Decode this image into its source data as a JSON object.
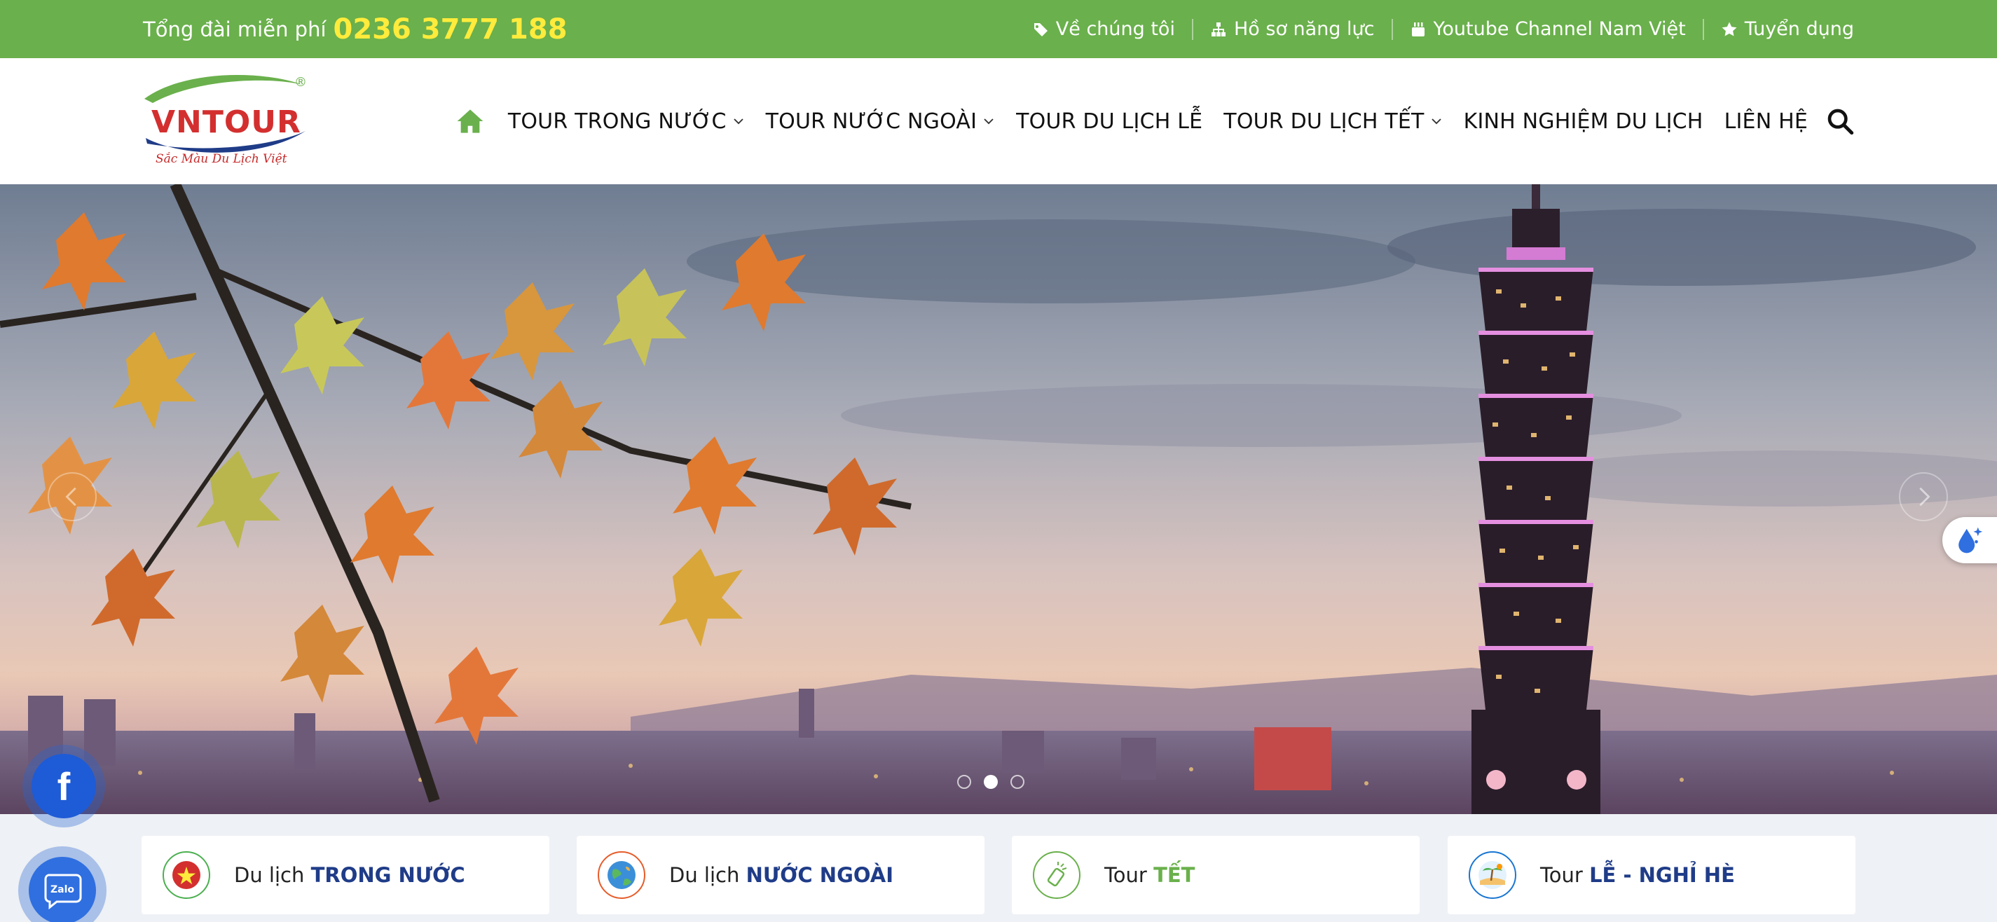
{
  "topbar": {
    "hotline_label": "Tổng đài miễn phí",
    "hotline_number": "0236 3777 188",
    "links": [
      {
        "label": "Về chúng tôi",
        "icon": "tag-icon"
      },
      {
        "label": "Hồ sơ năng lực",
        "icon": "sitemap-icon"
      },
      {
        "label": "Youtube Channel Nam Việt",
        "icon": "youtube-icon"
      },
      {
        "label": "Tuyển dụng",
        "icon": "star-icon"
      }
    ]
  },
  "header": {
    "logo_text": "VNTOUR",
    "logo_registered": "®",
    "logo_tagline": "Sắc Màu Du Lịch Việt",
    "nav": [
      {
        "label": "TOUR TRONG NƯỚC",
        "dropdown": true
      },
      {
        "label": "TOUR NƯỚC NGOÀI",
        "dropdown": true
      },
      {
        "label": "TOUR DU LỊCH LỄ",
        "dropdown": false
      },
      {
        "label": "TOUR DU LỊCH TẾT",
        "dropdown": true
      },
      {
        "label": "KINH NGHIỆM DU LỊCH",
        "dropdown": false
      },
      {
        "label": "LIÊN HỆ",
        "dropdown": false
      }
    ]
  },
  "hero": {
    "slide_count": 3,
    "active_slide": 2
  },
  "categories": [
    {
      "prefix": "Du lịch",
      "highlight": "TRONG NƯỚC",
      "color": "#1f3c88",
      "icon": "vietnam-flag-icon",
      "ring": "#4caf50"
    },
    {
      "prefix": "Du lịch",
      "highlight": "NƯỚC NGOÀI",
      "color": "#1f3c88",
      "icon": "globe-icon",
      "ring": "#e65c2a"
    },
    {
      "prefix": "Tour",
      "highlight": "TẾT",
      "color": "#6ab04c",
      "icon": "firecracker-icon",
      "ring": "#6ab04c"
    },
    {
      "prefix": "Tour",
      "highlight": "LỄ - NGHỈ HÈ",
      "color": "#1f3c88",
      "icon": "beach-icon",
      "ring": "#1976d2"
    }
  ],
  "colors": {
    "brand_green": "#6ab04c",
    "hotline_yellow": "#ffeb3b",
    "navy": "#1f3c88"
  }
}
